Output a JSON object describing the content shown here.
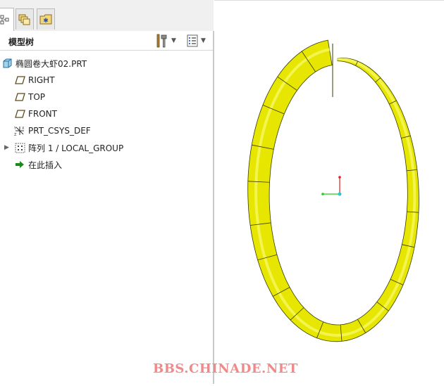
{
  "tabs": [
    {
      "icon": "model-tree-icon"
    },
    {
      "icon": "layers-icon"
    },
    {
      "icon": "favorites-folder-icon"
    }
  ],
  "panel": {
    "title": "模型树",
    "tools_icon": "settings-tools-icon",
    "display_icon": "tree-display-icon"
  },
  "tree": {
    "items": [
      {
        "label": "椭圆卷大虾02.PRT",
        "icon": "part-icon"
      },
      {
        "label": "RIGHT",
        "icon": "datum-plane-icon"
      },
      {
        "label": "TOP",
        "icon": "datum-plane-icon"
      },
      {
        "label": "FRONT",
        "icon": "datum-plane-icon"
      },
      {
        "label": "PRT_CSYS_DEF",
        "icon": "coordinate-system-icon"
      },
      {
        "label": "阵列 1 / LOCAL_GROUP",
        "icon": "pattern-icon"
      },
      {
        "label": "在此插入",
        "icon": "insert-here-arrow-icon"
      }
    ]
  },
  "watermark": "BBS.CHINADE.NET",
  "colors": {
    "model": "#e6e600",
    "model_edge": "#3a3a00",
    "axis_x": "#22cc22",
    "axis_y": "#e02020",
    "origin": "#22cccc",
    "watermark": "#f08a8a"
  }
}
